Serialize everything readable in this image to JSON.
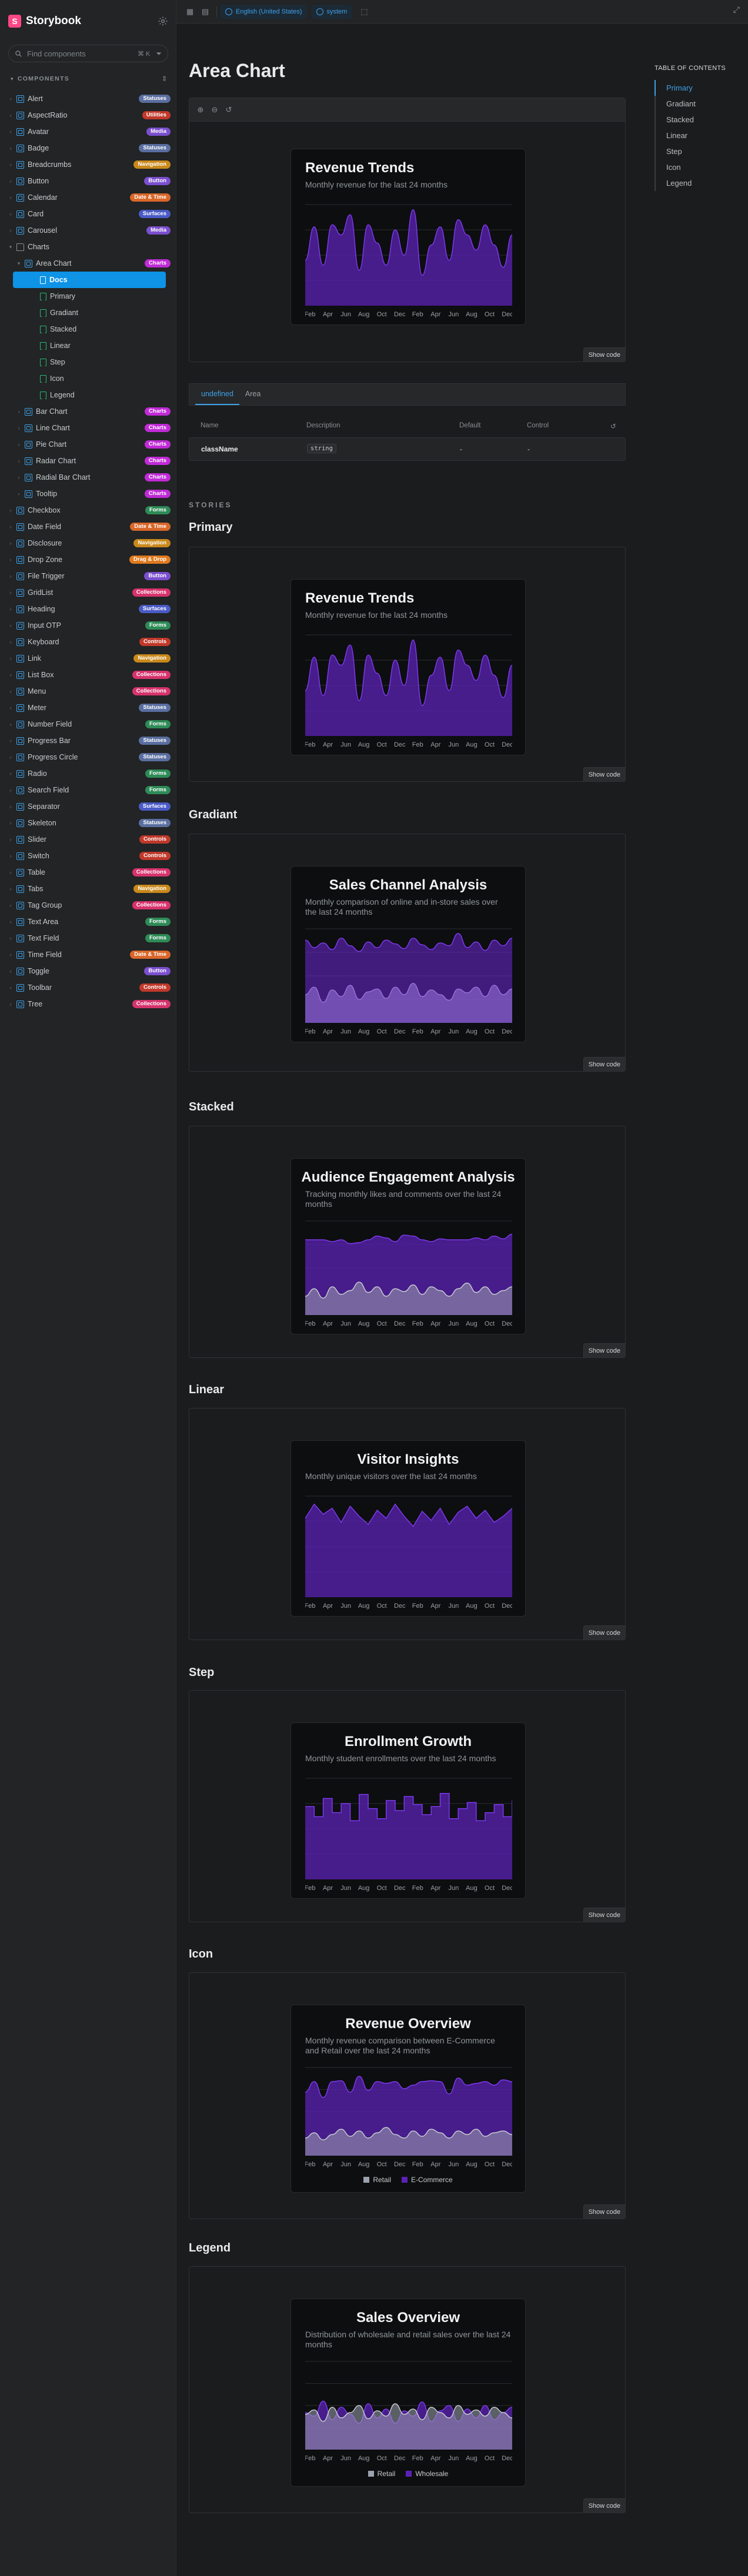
{
  "app": {
    "title": "Storybook",
    "logo_letter": "S"
  },
  "search": {
    "placeholder": "Find components",
    "shortcut": "⌘ K"
  },
  "sidebar": {
    "section_title": "COMPONENTS",
    "items": [
      {
        "label": "Alert",
        "badge": "Statuses",
        "color": "#5a6ea0",
        "kind": "comp",
        "depth": 0
      },
      {
        "label": "AspectRatio",
        "badge": "Utilities",
        "color": "#c0392b",
        "kind": "comp",
        "depth": 0
      },
      {
        "label": "Avatar",
        "badge": "Media",
        "color": "#7b4fcf",
        "kind": "comp",
        "depth": 0
      },
      {
        "label": "Badge",
        "badge": "Statuses",
        "color": "#5a6ea0",
        "kind": "comp",
        "depth": 0
      },
      {
        "label": "Breadcrumbs",
        "badge": "Navigation",
        "color": "#c9891b",
        "kind": "comp",
        "depth": 0
      },
      {
        "label": "Button",
        "badge": "Button",
        "color": "#7b4fcf",
        "kind": "comp",
        "depth": 0
      },
      {
        "label": "Calendar",
        "badge": "Date & Time",
        "color": "#d9672a",
        "kind": "comp",
        "depth": 0
      },
      {
        "label": "Card",
        "badge": "Surfaces",
        "color": "#4a5bc7",
        "kind": "comp",
        "depth": 0
      },
      {
        "label": "Carousel",
        "badge": "Media",
        "color": "#7b4fcf",
        "kind": "comp",
        "depth": 0
      },
      {
        "label": "Charts",
        "badge": "",
        "color": "",
        "kind": "folder",
        "depth": 0,
        "open": true
      },
      {
        "label": "Area Chart",
        "badge": "Charts",
        "color": "#c02bd6",
        "kind": "comp",
        "depth": 1,
        "open": true
      },
      {
        "label": "Docs",
        "badge": "",
        "color": "",
        "kind": "doc",
        "depth": 2,
        "selected": true
      },
      {
        "label": "Primary",
        "badge": "",
        "color": "",
        "kind": "story",
        "depth": 2
      },
      {
        "label": "Gradiant",
        "badge": "",
        "color": "",
        "kind": "story",
        "depth": 2
      },
      {
        "label": "Stacked",
        "badge": "",
        "color": "",
        "kind": "story",
        "depth": 2
      },
      {
        "label": "Linear",
        "badge": "",
        "color": "",
        "kind": "story",
        "depth": 2
      },
      {
        "label": "Step",
        "badge": "",
        "color": "",
        "kind": "story",
        "depth": 2
      },
      {
        "label": "Icon",
        "badge": "",
        "color": "",
        "kind": "story",
        "depth": 2
      },
      {
        "label": "Legend",
        "badge": "",
        "color": "",
        "kind": "story",
        "depth": 2
      },
      {
        "label": "Bar Chart",
        "badge": "Charts",
        "color": "#c02bd6",
        "kind": "comp",
        "depth": 1
      },
      {
        "label": "Line Chart",
        "badge": "Charts",
        "color": "#c02bd6",
        "kind": "comp",
        "depth": 1
      },
      {
        "label": "Pie Chart",
        "badge": "Charts",
        "color": "#c02bd6",
        "kind": "comp",
        "depth": 1
      },
      {
        "label": "Radar Chart",
        "badge": "Charts",
        "color": "#c02bd6",
        "kind": "comp",
        "depth": 1
      },
      {
        "label": "Radial Bar Chart",
        "badge": "Charts",
        "color": "#c02bd6",
        "kind": "comp",
        "depth": 1
      },
      {
        "label": "Tooltip",
        "badge": "Charts",
        "color": "#c02bd6",
        "kind": "comp",
        "depth": 1
      },
      {
        "label": "Checkbox",
        "badge": "Forms",
        "color": "#2e8b57",
        "kind": "comp",
        "depth": 0
      },
      {
        "label": "Date Field",
        "badge": "Date & Time",
        "color": "#d9672a",
        "kind": "comp",
        "depth": 0
      },
      {
        "label": "Disclosure",
        "badge": "Navigation",
        "color": "#c9891b",
        "kind": "comp",
        "depth": 0
      },
      {
        "label": "Drop Zone",
        "badge": "Drag & Drop",
        "color": "#e07a1f",
        "kind": "comp",
        "depth": 0
      },
      {
        "label": "File Trigger",
        "badge": "Button",
        "color": "#7b4fcf",
        "kind": "comp",
        "depth": 0
      },
      {
        "label": "GridList",
        "badge": "Collections",
        "color": "#d6336c",
        "kind": "comp",
        "depth": 0
      },
      {
        "label": "Heading",
        "badge": "Surfaces",
        "color": "#4a5bc7",
        "kind": "comp",
        "depth": 0
      },
      {
        "label": "Input OTP",
        "badge": "Forms",
        "color": "#2e8b57",
        "kind": "comp",
        "depth": 0
      },
      {
        "label": "Keyboard",
        "badge": "Controls",
        "color": "#c0392b",
        "kind": "comp",
        "depth": 0
      },
      {
        "label": "Link",
        "badge": "Navigation",
        "color": "#c9891b",
        "kind": "comp",
        "depth": 0
      },
      {
        "label": "List Box",
        "badge": "Collections",
        "color": "#d6336c",
        "kind": "comp",
        "depth": 0
      },
      {
        "label": "Menu",
        "badge": "Collections",
        "color": "#d6336c",
        "kind": "comp",
        "depth": 0
      },
      {
        "label": "Meter",
        "badge": "Statuses",
        "color": "#5a6ea0",
        "kind": "comp",
        "depth": 0
      },
      {
        "label": "Number Field",
        "badge": "Forms",
        "color": "#2e8b57",
        "kind": "comp",
        "depth": 0
      },
      {
        "label": "Progress Bar",
        "badge": "Statuses",
        "color": "#5a6ea0",
        "kind": "comp",
        "depth": 0
      },
      {
        "label": "Progress Circle",
        "badge": "Statuses",
        "color": "#5a6ea0",
        "kind": "comp",
        "depth": 0
      },
      {
        "label": "Radio",
        "badge": "Forms",
        "color": "#2e8b57",
        "kind": "comp",
        "depth": 0
      },
      {
        "label": "Search Field",
        "badge": "Forms",
        "color": "#2e8b57",
        "kind": "comp",
        "depth": 0
      },
      {
        "label": "Separator",
        "badge": "Surfaces",
        "color": "#4a5bc7",
        "kind": "comp",
        "depth": 0
      },
      {
        "label": "Skeleton",
        "badge": "Statuses",
        "color": "#5a6ea0",
        "kind": "comp",
        "depth": 0
      },
      {
        "label": "Slider",
        "badge": "Controls",
        "color": "#c0392b",
        "kind": "comp",
        "depth": 0
      },
      {
        "label": "Switch",
        "badge": "Controls",
        "color": "#c0392b",
        "kind": "comp",
        "depth": 0
      },
      {
        "label": "Table",
        "badge": "Collections",
        "color": "#d6336c",
        "kind": "comp",
        "depth": 0
      },
      {
        "label": "Tabs",
        "badge": "Navigation",
        "color": "#c9891b",
        "kind": "comp",
        "depth": 0
      },
      {
        "label": "Tag Group",
        "badge": "Collections",
        "color": "#d6336c",
        "kind": "comp",
        "depth": 0
      },
      {
        "label": "Text Area",
        "badge": "Forms",
        "color": "#2e8b57",
        "kind": "comp",
        "depth": 0
      },
      {
        "label": "Text Field",
        "badge": "Forms",
        "color": "#2e8b57",
        "kind": "comp",
        "depth": 0
      },
      {
        "label": "Time Field",
        "badge": "Date & Time",
        "color": "#d9672a",
        "kind": "comp",
        "depth": 0
      },
      {
        "label": "Toggle",
        "badge": "Button",
        "color": "#7b4fcf",
        "kind": "comp",
        "depth": 0
      },
      {
        "label": "Toolbar",
        "badge": "Controls",
        "color": "#c0392b",
        "kind": "comp",
        "depth": 0
      },
      {
        "label": "Tree",
        "badge": "Collections",
        "color": "#d6336c",
        "kind": "comp",
        "depth": 0
      }
    ]
  },
  "toolbar": {
    "locale": "English (United States)",
    "theme": "system"
  },
  "page": {
    "title": "Area Chart",
    "show_code": "Show code",
    "stories_label": "STORIES"
  },
  "props": {
    "tabs": [
      "undefined",
      "Area"
    ],
    "headers": {
      "name": "Name",
      "description": "Description",
      "default": "Default",
      "control": "Control"
    },
    "row": {
      "name": "className",
      "type": "string",
      "default": "-",
      "control": "-"
    }
  },
  "toc": {
    "title": "TABLE OF CONTENTS",
    "items": [
      "Primary",
      "Gradiant",
      "Stacked",
      "Linear",
      "Step",
      "Icon",
      "Legend"
    ]
  },
  "stories": [
    {
      "heading": "",
      "title": "Revenue Trends",
      "subtitle": "Monthly revenue for the last 24 months",
      "align": "left"
    },
    {
      "heading": "Primary",
      "title": "Revenue Trends",
      "subtitle": "Monthly revenue for the last 24 months",
      "align": "left"
    },
    {
      "heading": "Gradiant",
      "title": "Sales Channel Analysis",
      "subtitle": "Monthly comparison of online and in-store sales over the last 24 months",
      "align": "center"
    },
    {
      "heading": "Stacked",
      "title": "Audience Engagement Analysis",
      "subtitle": "Tracking monthly likes and comments over the last 24 months",
      "align": "center"
    },
    {
      "heading": "Linear",
      "title": "Visitor Insights",
      "subtitle": "Monthly unique visitors over the last 24 months",
      "align": "center"
    },
    {
      "heading": "Step",
      "title": "Enrollment Growth",
      "subtitle": "Monthly student enrollments over the last 24 months",
      "align": "center"
    },
    {
      "heading": "Icon",
      "title": "Revenue Overview",
      "subtitle": "Monthly revenue comparison between E-Commerce and Retail over the last 24 months",
      "align": "center",
      "legend": [
        "Retail",
        "E-Commerce"
      ]
    },
    {
      "heading": "Legend",
      "title": "Sales Overview",
      "subtitle": "Distribution of wholesale and retail sales over the last 24 months",
      "align": "center",
      "legend": [
        "Retail",
        "Wholesale"
      ]
    }
  ],
  "chart_data": [
    {
      "type": "area",
      "variant": "natural",
      "x": [
        "Feb",
        "Apr",
        "Jun",
        "Aug",
        "Oct",
        "Dec",
        "Feb",
        "Apr",
        "Jun",
        "Aug",
        "Oct",
        "Dec"
      ],
      "series": [
        {
          "values": [
            45,
            78,
            40,
            80,
            70,
            90,
            35,
            80,
            62,
            40,
            75,
            50,
            95,
            30,
            60,
            78,
            45,
            85,
            70,
            55,
            80,
            60,
            38,
            70
          ]
        }
      ],
      "colors": [
        "#5b21b6"
      ]
    },
    {
      "type": "area",
      "variant": "natural",
      "x": [
        "Feb",
        "Apr",
        "Jun",
        "Aug",
        "Oct",
        "Dec",
        "Feb",
        "Apr",
        "Jun",
        "Aug",
        "Oct",
        "Dec"
      ],
      "series": [
        {
          "values": [
            45,
            78,
            40,
            80,
            70,
            90,
            35,
            80,
            62,
            40,
            75,
            50,
            95,
            30,
            60,
            78,
            45,
            85,
            70,
            55,
            80,
            60,
            38,
            70
          ]
        }
      ],
      "colors": [
        "#5b21b6"
      ]
    },
    {
      "type": "area",
      "variant": "gradient",
      "x": [
        "Feb",
        "Apr",
        "Jun",
        "Aug",
        "Oct",
        "Dec",
        "Feb",
        "Apr",
        "Jun",
        "Aug",
        "Oct",
        "Dec"
      ],
      "series": [
        {
          "values": [
            88,
            80,
            85,
            78,
            90,
            82,
            76,
            86,
            80,
            88,
            84,
            79,
            90,
            83,
            78,
            85,
            82,
            95,
            80,
            86,
            77,
            88,
            82,
            90
          ]
        },
        {
          "values": [
            30,
            38,
            22,
            35,
            28,
            40,
            25,
            33,
            36,
            26,
            38,
            30,
            42,
            28,
            35,
            30,
            24,
            36,
            32,
            38,
            28,
            40,
            30,
            36
          ]
        }
      ],
      "colors": [
        "#6d28d9",
        "#9ca3af"
      ]
    },
    {
      "type": "area",
      "variant": "stacked",
      "x": [
        "Feb",
        "Apr",
        "Jun",
        "Aug",
        "Oct",
        "Dec",
        "Feb",
        "Apr",
        "Jun",
        "Aug",
        "Oct",
        "Dec"
      ],
      "series": [
        {
          "values": [
            20,
            28,
            18,
            30,
            22,
            26,
            35,
            24,
            30,
            20,
            28,
            25,
            32,
            22,
            30,
            26,
            20,
            28,
            34,
            24,
            30,
            22,
            26,
            30
          ]
        },
        {
          "values": [
            60,
            52,
            62,
            48,
            58,
            50,
            42,
            56,
            54,
            62,
            50,
            60,
            52,
            58,
            48,
            55,
            60,
            52,
            46,
            58,
            50,
            62,
            55,
            56
          ]
        }
      ],
      "colors": [
        "#9ca3af",
        "#5b21b6"
      ]
    },
    {
      "type": "area",
      "variant": "linear",
      "x": [
        "Feb",
        "Apr",
        "Jun",
        "Aug",
        "Oct",
        "Dec",
        "Feb",
        "Apr",
        "Jun",
        "Aug",
        "Oct",
        "Dec"
      ],
      "series": [
        {
          "values": [
            78,
            92,
            82,
            88,
            74,
            90,
            80,
            72,
            86,
            78,
            92,
            80,
            70,
            85,
            76,
            88,
            72,
            84,
            90,
            78,
            86,
            74,
            80,
            88
          ]
        }
      ],
      "colors": [
        "#5b21b6"
      ]
    },
    {
      "type": "area",
      "variant": "step",
      "x": [
        "Feb",
        "Apr",
        "Jun",
        "Aug",
        "Oct",
        "Dec",
        "Feb",
        "Apr",
        "Jun",
        "Aug",
        "Oct",
        "Dec"
      ],
      "series": [
        {
          "values": [
            72,
            62,
            80,
            66,
            75,
            58,
            84,
            70,
            60,
            78,
            68,
            82,
            74,
            64,
            72,
            85,
            60,
            70,
            76,
            58,
            66,
            74,
            62,
            78
          ]
        }
      ],
      "colors": [
        "#5b21b6"
      ]
    },
    {
      "type": "area",
      "variant": "icon",
      "x": [
        "Feb",
        "Apr",
        "Jun",
        "Aug",
        "Oct",
        "Dec",
        "Feb",
        "Apr",
        "Jun",
        "Aug",
        "Oct",
        "Dec"
      ],
      "series": [
        {
          "name": "Retail",
          "values": [
            20,
            26,
            18,
            24,
            30,
            22,
            28,
            20,
            26,
            32,
            24,
            20,
            28,
            22,
            30,
            26,
            20,
            28,
            24,
            30,
            22,
            26,
            28,
            24
          ]
        },
        {
          "name": "E-Commerce",
          "values": [
            52,
            58,
            48,
            60,
            55,
            50,
            62,
            54,
            58,
            50,
            60,
            56,
            52,
            62,
            55,
            58,
            50,
            60,
            56,
            52,
            62,
            54,
            58,
            60
          ]
        }
      ],
      "colors": [
        "#9ca3af",
        "#5b21b6"
      ]
    },
    {
      "type": "area",
      "variant": "legend",
      "x": [
        "Feb",
        "Apr",
        "Jun",
        "Aug",
        "Oct",
        "Dec",
        "Feb",
        "Apr",
        "Jun",
        "Aug",
        "Oct",
        "Dec"
      ],
      "series": [
        {
          "name": "Retail",
          "values": [
            40,
            45,
            32,
            48,
            36,
            42,
            50,
            35,
            44,
            38,
            52,
            40,
            46,
            34,
            48,
            42,
            36,
            50,
            40,
            45,
            38,
            48,
            42,
            36
          ]
        },
        {
          "name": "Wholesale",
          "values": [
            42,
            38,
            55,
            34,
            48,
            40,
            30,
            52,
            36,
            46,
            30,
            44,
            38,
            54,
            32,
            44,
            50,
            32,
            46,
            36,
            50,
            34,
            42,
            48
          ]
        }
      ],
      "colors": [
        "#9ca3af",
        "#5b21b6"
      ]
    }
  ]
}
